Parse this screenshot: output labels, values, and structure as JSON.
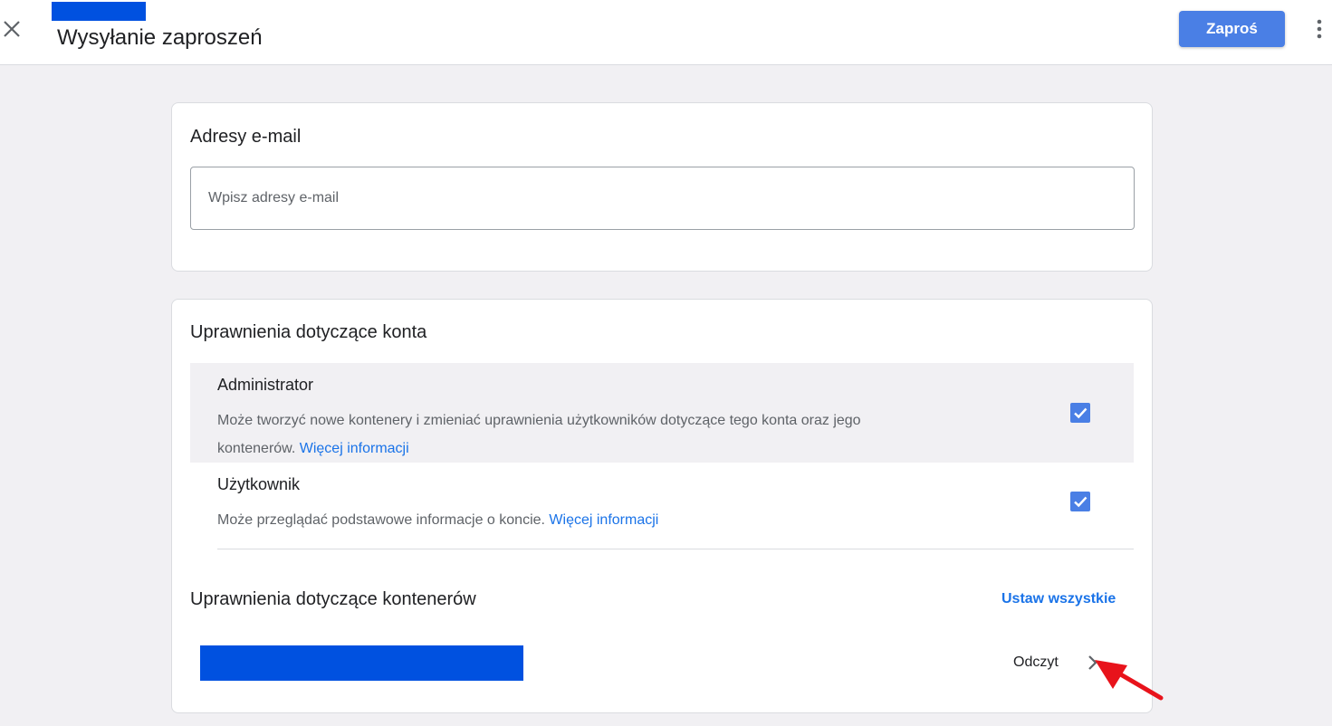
{
  "header": {
    "title": "Wysyłanie zaproszeń",
    "invite_label": "Zaproś"
  },
  "email_section": {
    "title": "Adresy e-mail",
    "placeholder": "Wpisz adresy e-mail",
    "value": ""
  },
  "account_permissions": {
    "title": "Uprawnienia dotyczące konta",
    "roles": [
      {
        "name": "Administrator",
        "description": "Może tworzyć nowe kontenery i zmieniać uprawnienia użytkowników dotyczące tego konta oraz jego kontenerów.",
        "link": "Więcej informacji",
        "checked": true
      },
      {
        "name": "Użytkownik",
        "description": "Może przeglądać podstawowe informacje o koncie.",
        "link": "Więcej informacji",
        "checked": true
      }
    ]
  },
  "container_permissions": {
    "title": "Uprawnienia dotyczące kontenerów",
    "set_all_label": "Ustaw wszystkie",
    "rows": [
      {
        "permission": "Odczyt"
      }
    ]
  },
  "colors": {
    "accent": "#4a7fe5",
    "link": "#1a73e8",
    "redaction": "#0051e0",
    "annotation_arrow": "#e8131b"
  },
  "icons": [
    "close-icon",
    "more-vert-icon",
    "check-icon",
    "chevron-right-icon"
  ]
}
